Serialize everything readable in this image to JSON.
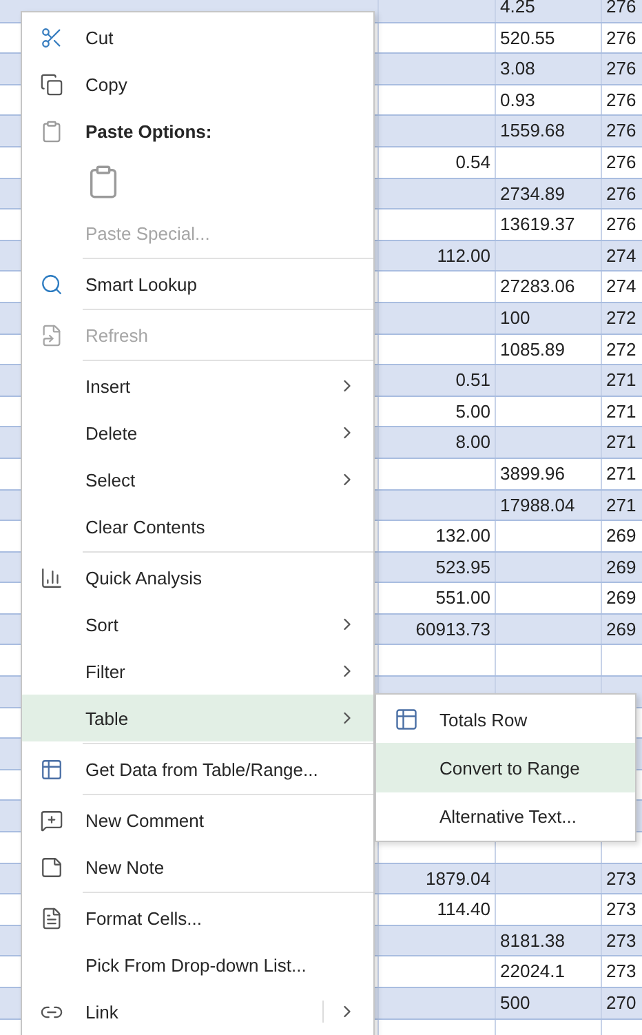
{
  "sheet": {
    "rows": [
      {
        "b": "4.25",
        "c": "276"
      },
      {
        "b": "520.55",
        "c": "276"
      },
      {
        "b": "3.08",
        "c": "276"
      },
      {
        "b": "0.93",
        "c": "276"
      },
      {
        "b": "1559.68",
        "c": "276"
      },
      {
        "a": "0.54",
        "c": "276"
      },
      {
        "b": "2734.89",
        "c": "276"
      },
      {
        "b": "13619.37",
        "c": "276"
      },
      {
        "a": "112.00",
        "c": "274"
      },
      {
        "b": "27283.06",
        "c": "274"
      },
      {
        "b": "100",
        "c": "272"
      },
      {
        "b": "1085.89",
        "c": "272"
      },
      {
        "a": "0.51",
        "c": "271"
      },
      {
        "a": "5.00",
        "c": "271"
      },
      {
        "a": "8.00",
        "c": "271"
      },
      {
        "b": "3899.96",
        "c": "271"
      },
      {
        "b": "17988.04",
        "c": "271"
      },
      {
        "a": "132.00",
        "c": "269"
      },
      {
        "a": "523.95",
        "c": "269"
      },
      {
        "a": "551.00",
        "c": "269"
      },
      {
        "a": "60913.73",
        "c": "269"
      },
      {},
      {},
      {},
      {},
      {},
      {},
      {},
      {
        "a": "1879.04",
        "c": "273"
      },
      {
        "a": "114.40",
        "c": "273"
      },
      {
        "b": "8181.38",
        "c": "273"
      },
      {
        "b": "22024.1",
        "c": "273"
      },
      {
        "b": "500",
        "c": "270"
      },
      {}
    ]
  },
  "context_menu": {
    "items": [
      {
        "kind": "command",
        "label": "Cut",
        "disabled": false,
        "submenu": false,
        "selected": false
      },
      {
        "kind": "command",
        "label": "Copy",
        "disabled": false,
        "submenu": false,
        "selected": false
      },
      {
        "kind": "header",
        "label": "Paste Options:"
      },
      {
        "kind": "paste-option"
      },
      {
        "kind": "command",
        "label": "Paste Special...",
        "disabled": true,
        "submenu": false,
        "selected": false
      },
      {
        "kind": "separator"
      },
      {
        "kind": "command",
        "label": "Smart Lookup",
        "disabled": false,
        "submenu": false,
        "selected": false
      },
      {
        "kind": "separator"
      },
      {
        "kind": "command",
        "label": "Refresh",
        "disabled": true,
        "submenu": false,
        "selected": false
      },
      {
        "kind": "separator"
      },
      {
        "kind": "command",
        "label": "Insert",
        "disabled": false,
        "submenu": true,
        "selected": false
      },
      {
        "kind": "command",
        "label": "Delete",
        "disabled": false,
        "submenu": true,
        "selected": false
      },
      {
        "kind": "command",
        "label": "Select",
        "disabled": false,
        "submenu": true,
        "selected": false
      },
      {
        "kind": "command",
        "label": "Clear Contents",
        "disabled": false,
        "submenu": false,
        "selected": false
      },
      {
        "kind": "separator"
      },
      {
        "kind": "command",
        "label": "Quick Analysis",
        "disabled": false,
        "submenu": false,
        "selected": false
      },
      {
        "kind": "command",
        "label": "Sort",
        "disabled": false,
        "submenu": true,
        "selected": false
      },
      {
        "kind": "command",
        "label": "Filter",
        "disabled": false,
        "submenu": true,
        "selected": false
      },
      {
        "kind": "command",
        "label": "Table",
        "disabled": false,
        "submenu": true,
        "selected": true
      },
      {
        "kind": "separator"
      },
      {
        "kind": "command",
        "label": "Get Data from Table/Range...",
        "disabled": false,
        "submenu": false,
        "selected": false
      },
      {
        "kind": "separator"
      },
      {
        "kind": "command",
        "label": "New Comment",
        "disabled": false,
        "submenu": false,
        "selected": false
      },
      {
        "kind": "command",
        "label": "New Note",
        "disabled": false,
        "submenu": false,
        "selected": false
      },
      {
        "kind": "separator"
      },
      {
        "kind": "command",
        "label": "Format Cells...",
        "disabled": false,
        "submenu": false,
        "selected": false
      },
      {
        "kind": "command",
        "label": "Pick From Drop-down List...",
        "disabled": false,
        "submenu": false,
        "selected": false
      },
      {
        "kind": "command",
        "label": "Link",
        "disabled": false,
        "submenu": true,
        "split": true,
        "selected": false
      }
    ]
  },
  "submenu": {
    "items": [
      {
        "label": "Totals Row",
        "selected": false
      },
      {
        "label": "Convert to Range",
        "selected": true
      },
      {
        "label": "Alternative Text...",
        "selected": false
      }
    ]
  }
}
